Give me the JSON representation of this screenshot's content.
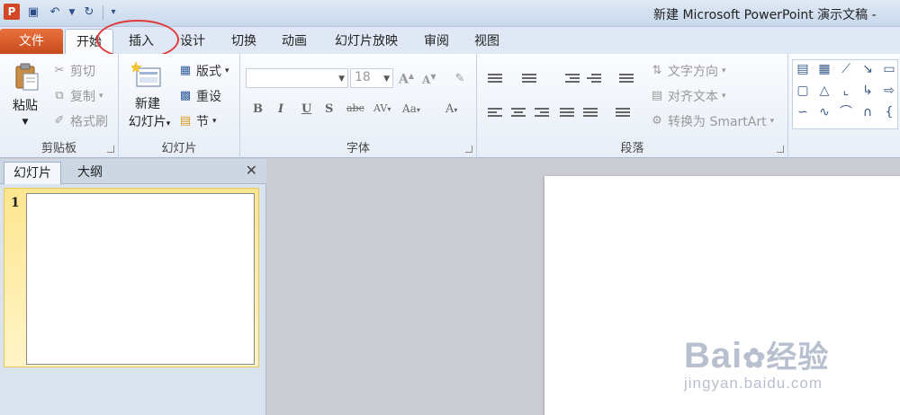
{
  "window": {
    "title": "新建 Microsoft PowerPoint 演示文稿 -"
  },
  "tabs": {
    "file": "文件",
    "items": [
      "开始",
      "插入",
      "设计",
      "切换",
      "动画",
      "幻灯片放映",
      "审阅",
      "视图"
    ]
  },
  "clipboard": {
    "paste": "粘贴",
    "cut": "剪切",
    "copy": "复制",
    "format_painter": "格式刷",
    "label": "剪贴板"
  },
  "slides_group": {
    "new_slide_1": "新建",
    "new_slide_2": "幻灯片",
    "layout": "版式",
    "reset": "重设",
    "section": "节",
    "label": "幻灯片"
  },
  "font": {
    "name_value": "",
    "size_value": "18",
    "label": "字体"
  },
  "paragraph": {
    "text_direction": "文字方向",
    "align_text": "对齐文本",
    "convert_smartart": "转换为 SmartArt",
    "label": "段落"
  },
  "pane": {
    "tab_slides": "幻灯片",
    "tab_outline": "大纲",
    "slide_number": "1"
  },
  "watermark": {
    "brand": "Bai",
    "brand_cn": "经验",
    "url": "jingyan.baidu.com"
  }
}
